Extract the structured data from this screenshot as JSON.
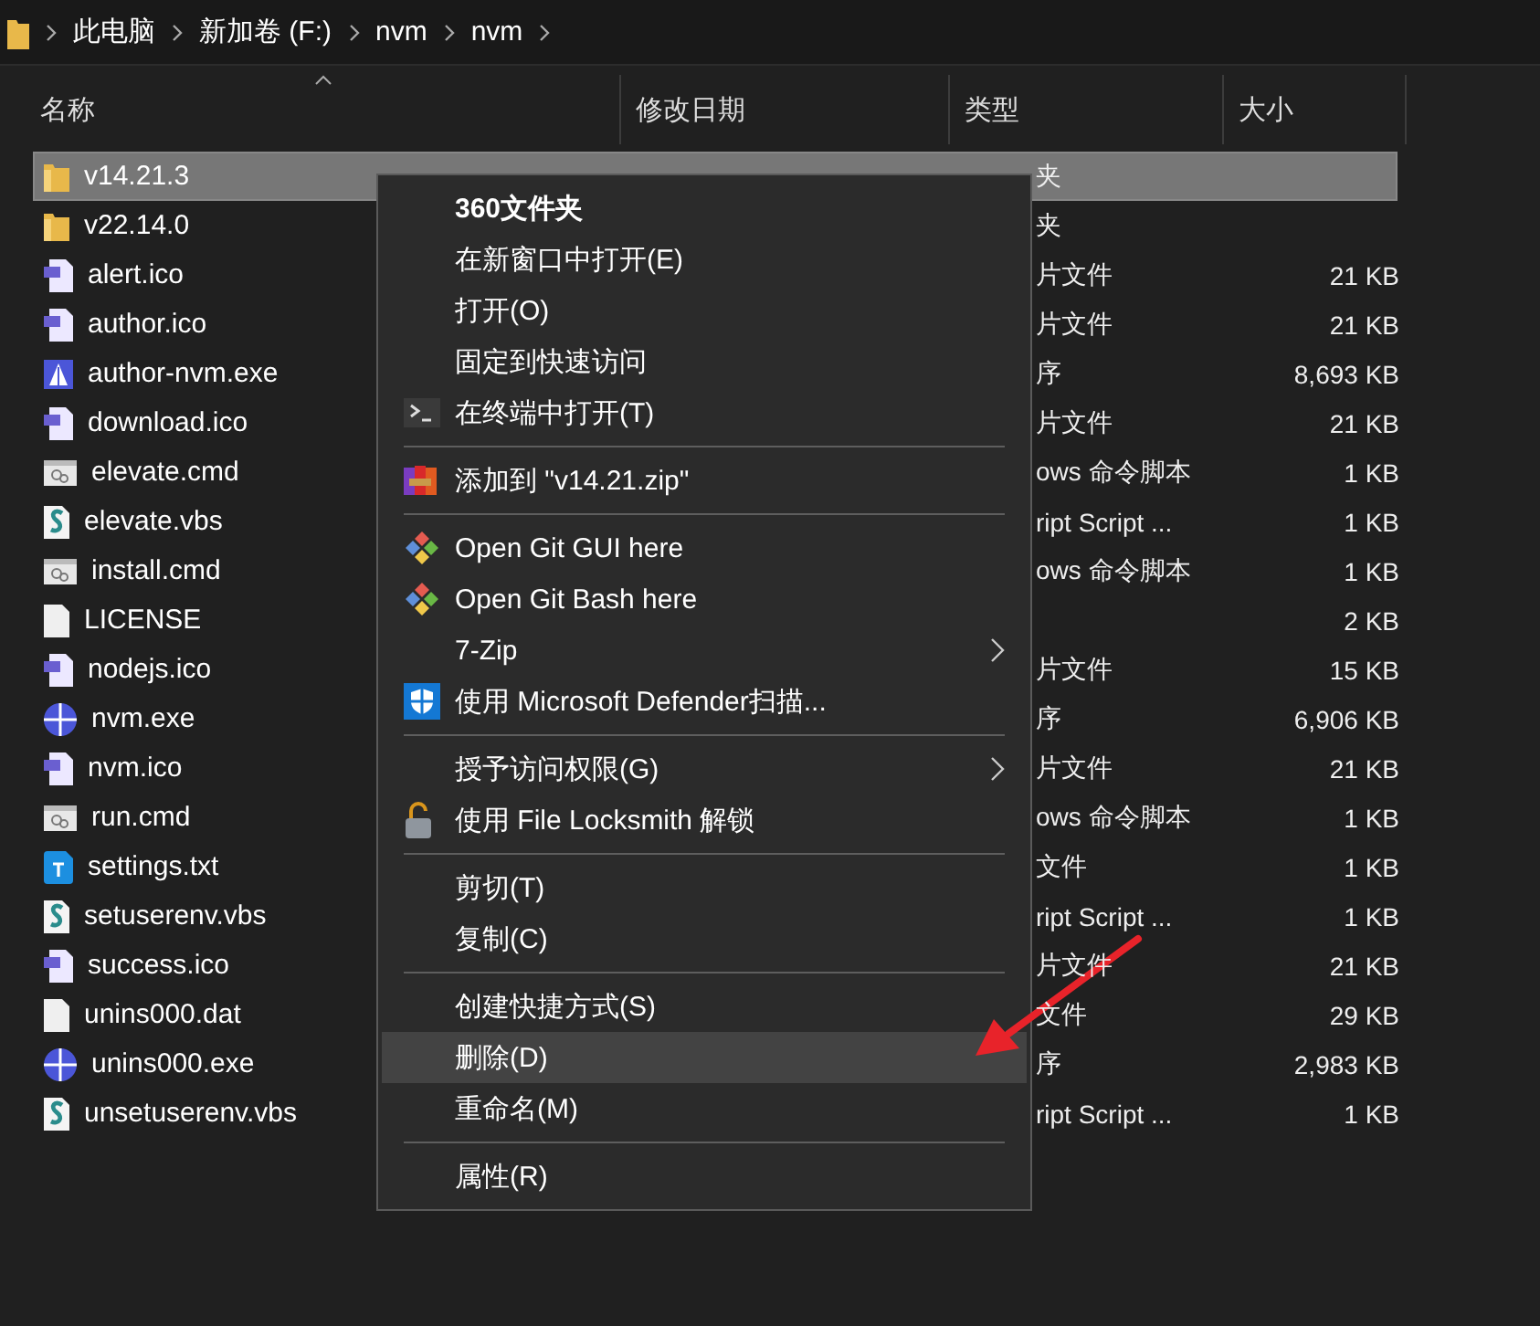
{
  "breadcrumb": [
    "此电脑",
    "新加卷 (F:)",
    "nvm",
    "nvm"
  ],
  "columns": [
    {
      "label": "名称",
      "sorted": true
    },
    {
      "label": "修改日期",
      "sorted": false
    },
    {
      "label": "类型",
      "sorted": false
    },
    {
      "label": "大小",
      "sorted": false
    }
  ],
  "files": [
    {
      "name": "v14.21.3",
      "kind": "folder",
      "type": "夹",
      "selected": true
    },
    {
      "name": "v22.14.0",
      "kind": "folder",
      "type": "夹",
      "selected": false
    },
    {
      "name": "alert.ico",
      "kind": "image",
      "type": "片文件",
      "size": "21 KB",
      "selected": false
    },
    {
      "name": "author.ico",
      "kind": "image",
      "type": "片文件",
      "size": "21 KB",
      "selected": false
    },
    {
      "name": "author-nvm.exe",
      "kind": "app",
      "type": "序",
      "size": "8,693 KB",
      "selected": false
    },
    {
      "name": "download.ico",
      "kind": "image",
      "type": "片文件",
      "size": "21 KB",
      "selected": false
    },
    {
      "name": "elevate.cmd",
      "kind": "batch",
      "type": "ows 命令脚本",
      "size": "1 KB",
      "selected": false
    },
    {
      "name": "elevate.vbs",
      "kind": "script",
      "type": "ript Script ...",
      "size": "1 KB",
      "selected": false
    },
    {
      "name": "install.cmd",
      "kind": "batch",
      "type": "ows 命令脚本",
      "size": "1 KB",
      "selected": false
    },
    {
      "name": "LICENSE",
      "kind": "plain",
      "size": "2 KB",
      "selected": false
    },
    {
      "name": "nodejs.ico",
      "kind": "image",
      "type": "片文件",
      "size": "15 KB",
      "selected": false
    },
    {
      "name": "nvm.exe",
      "kind": "globe",
      "type": "序",
      "size": "6,906 KB",
      "selected": false
    },
    {
      "name": "nvm.ico",
      "kind": "image",
      "type": "片文件",
      "size": "21 KB",
      "selected": false
    },
    {
      "name": "run.cmd",
      "kind": "batch",
      "type": "ows 命令脚本",
      "size": "1 KB",
      "selected": false
    },
    {
      "name": "settings.txt",
      "kind": "text",
      "type": "文件",
      "size": "1 KB",
      "selected": false
    },
    {
      "name": "setuserenv.vbs",
      "kind": "script",
      "type": "ript Script ...",
      "size": "1 KB",
      "selected": false
    },
    {
      "name": "success.ico",
      "kind": "image",
      "type": "片文件",
      "size": "21 KB",
      "selected": false
    },
    {
      "name": "unins000.dat",
      "kind": "plain",
      "type": "文件",
      "size": "29 KB",
      "selected": false
    },
    {
      "name": "unins000.exe",
      "kind": "globe",
      "type": "序",
      "size": "2,983 KB",
      "selected": false
    },
    {
      "name": "unsetuserenv.vbs",
      "kind": "script",
      "type": "ript Script ...",
      "size": "1 KB",
      "selected": false
    }
  ],
  "context_menu": [
    {
      "kind": "item",
      "label": "360文件夹",
      "bold": true,
      "selected": false
    },
    {
      "kind": "item",
      "label": "在新窗口中打开(E)",
      "bold": false,
      "selected": false
    },
    {
      "kind": "item",
      "label": "打开(O)",
      "bold": false,
      "selected": false
    },
    {
      "kind": "item",
      "label": "固定到快速访问",
      "bold": false,
      "selected": false
    },
    {
      "kind": "terminal",
      "label": "在终端中打开(T)",
      "bold": false,
      "selected": false
    },
    {
      "kind": "separator"
    },
    {
      "kind": "archive",
      "label": "添加到 \"v14.21.zip\"",
      "bold": false,
      "selected": false
    },
    {
      "kind": "separator"
    },
    {
      "kind": "git",
      "label": "Open Git GUI here",
      "bold": false,
      "selected": false
    },
    {
      "kind": "git",
      "label": "Open Git Bash here",
      "bold": false,
      "selected": false
    },
    {
      "kind": "submenu",
      "label": "7-Zip",
      "bold": false,
      "selected": false
    },
    {
      "kind": "shield",
      "label": "使用 Microsoft Defender扫描...",
      "bold": false,
      "selected": false
    },
    {
      "kind": "separator"
    },
    {
      "kind": "submenu",
      "label": "授予访问权限(G)",
      "bold": false,
      "selected": false
    },
    {
      "kind": "lock",
      "label": "使用 File Locksmith 解锁",
      "bold": false,
      "selected": false
    },
    {
      "kind": "separator"
    },
    {
      "kind": "item",
      "label": "剪切(T)",
      "bold": false,
      "selected": false
    },
    {
      "kind": "item",
      "label": "复制(C)",
      "bold": false,
      "selected": false
    },
    {
      "kind": "separator"
    },
    {
      "kind": "item",
      "label": "创建快捷方式(S)",
      "bold": false,
      "selected": false
    },
    {
      "kind": "item",
      "label": "删除(D)",
      "bold": false,
      "selected": true
    },
    {
      "kind": "item",
      "label": "重命名(M)",
      "bold": false,
      "selected": false
    },
    {
      "kind": "separator"
    },
    {
      "kind": "item",
      "label": "属性(R)",
      "bold": false,
      "selected": false
    }
  ]
}
